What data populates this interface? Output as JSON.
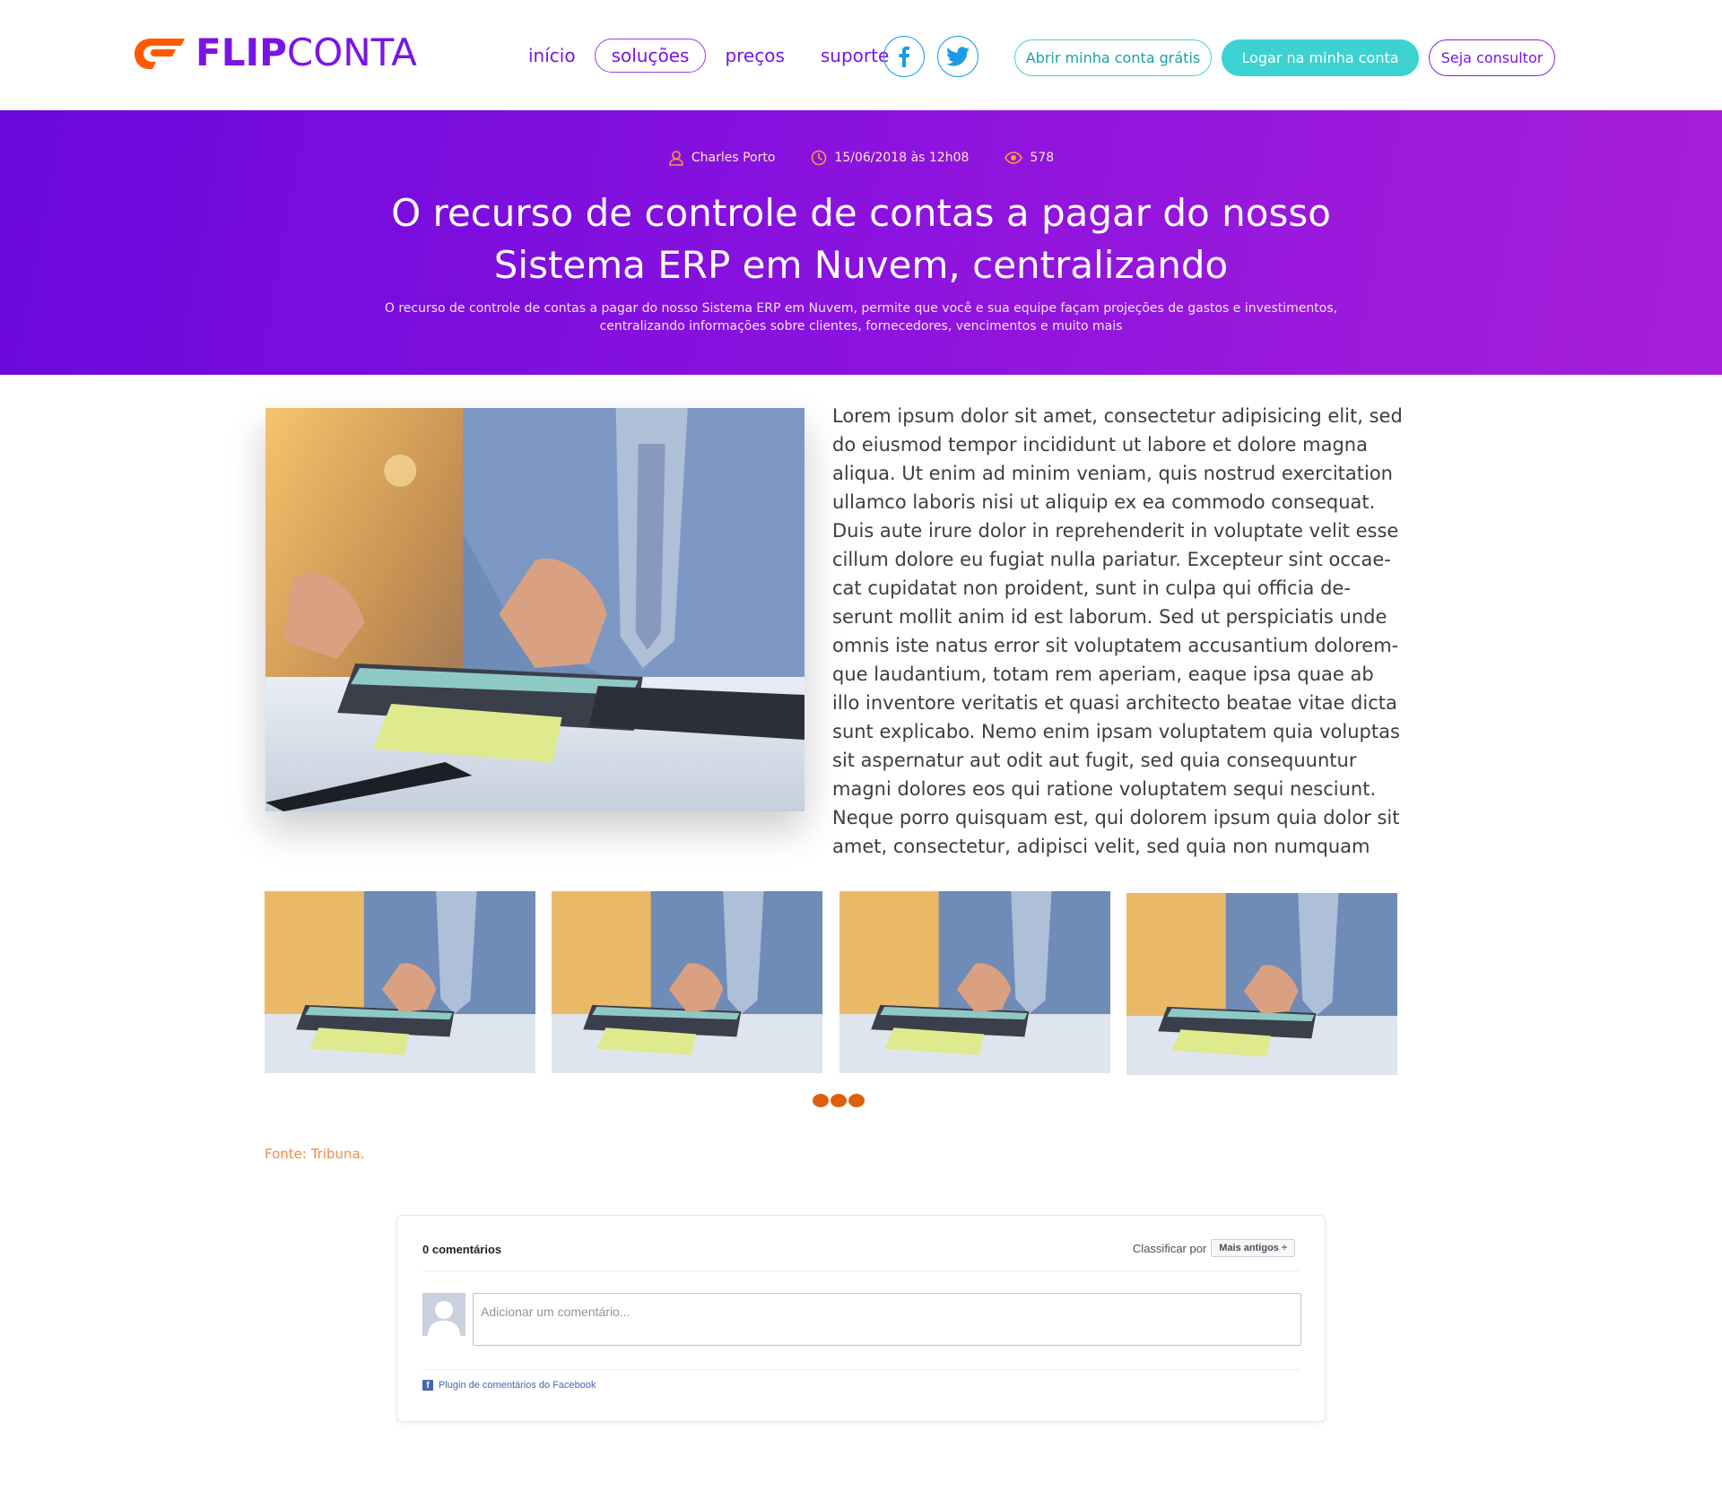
{
  "header": {
    "logo_flip": "FLIP",
    "logo_conta": "CONTA",
    "nav": [
      {
        "label": "início",
        "active": false
      },
      {
        "label": "soluções",
        "active": true
      },
      {
        "label": "preços",
        "active": false
      },
      {
        "label": "suporte",
        "active": false
      }
    ],
    "social": [
      "facebook-icon",
      "twitter-icon"
    ],
    "buttons": {
      "open_account": "Abrir minha conta grátis",
      "login": "Logar na minha conta",
      "consultant": "Seja consultor"
    }
  },
  "hero": {
    "author": "Charles Porto",
    "date": "15/06/2018 às 12h08",
    "views": "578",
    "title": "O recurso de controle de contas a pagar do nosso Sistema ERP em Nuvem, centralizando",
    "subtitle": "O recurso de controle de contas a pagar do nosso Sistema ERP em Nuvem, permite que você e sua equipe façam projeções de gastos e investimentos, centralizando informações sobre clientes, fornecedores, vencimentos e muito mais"
  },
  "article": {
    "body": "Lorem ipsum dolor sit amet, consectetur adipisicing elit, sed do eiusmod tempor incididunt ut labore et dolore magna aliqua. Ut enim ad minim veniam, quis nostrud exercitation ullamco laboris nisi ut aliquip ex ea commodo consequat. Duis aute irure dolor in reprehenderit in voluptate velit esse cillum dolore eu fugiat nulla pariatur. Excepteur sint occae-cat cupidatat non proident, sunt in culpa qui officia de-serunt mollit anim id est laborum. Sed ut perspiciatis unde omnis iste natus error sit voluptatem accusantium dolorem-que laudantium, totam rem aperiam, eaque ipsa quae ab illo inventore veritatis et quasi architecto beatae vitae dicta sunt explicabo. Nemo enim ipsam voluptatem quia voluptas sit aspernatur aut odit aut fugit, sed quia consequuntur magni dolores eos qui ratione voluptatem sequi nesciunt. Neque porro quisquam est, qui dolorem ipsum quia dolor sit amet, consectetur, adipisci velit, sed quia non numquam",
    "source": "Fonte: Tribuna."
  },
  "comments": {
    "count_label": "0 comentários",
    "sort_label": "Classificar por",
    "sort_value": "Mais antigos ÷",
    "input_placeholder": "Adicionar um comentário...",
    "plugin_label": "Plugin de comentários do Facebook"
  },
  "colors": {
    "brand_purple": "#7a14e6",
    "logo_orange": "#ff5a00",
    "teal": "#3dd2d2",
    "dots_orange": "#e05e10"
  }
}
